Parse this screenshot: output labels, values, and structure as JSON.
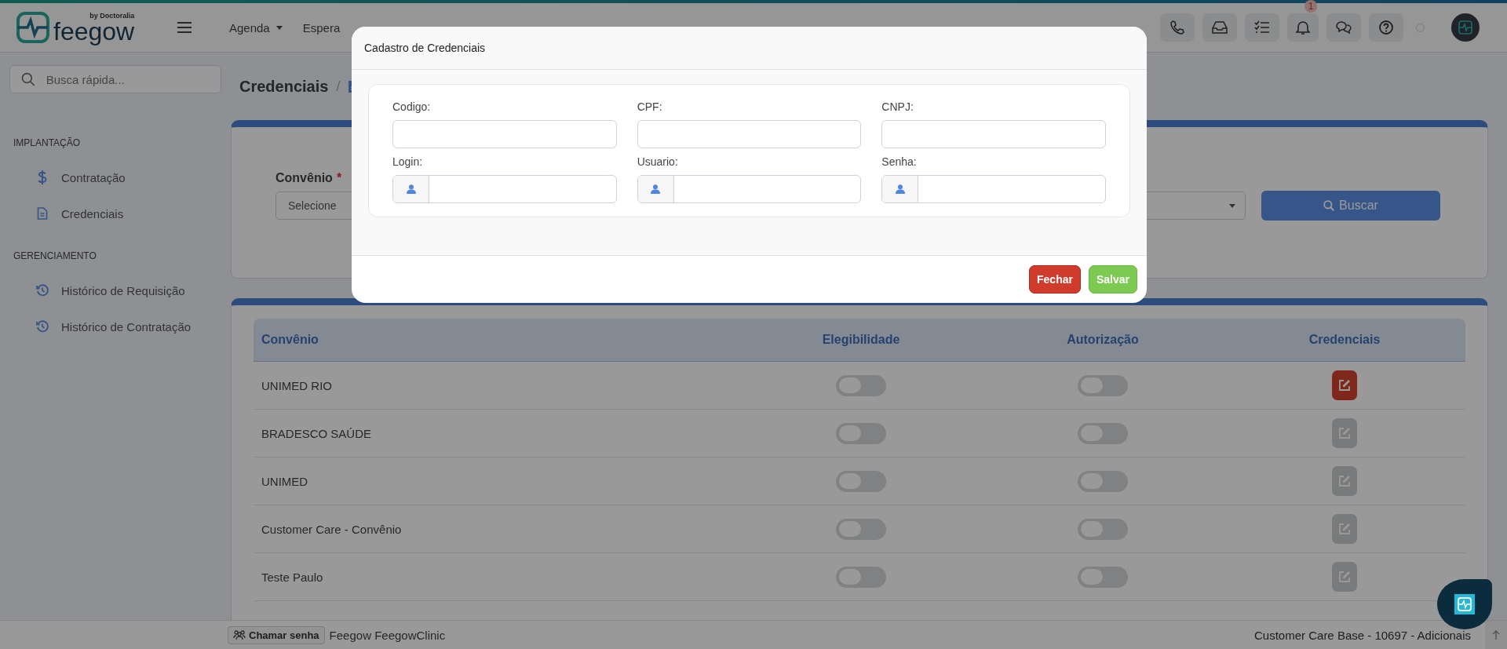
{
  "top_nav": {
    "logo": {
      "wordmark": "feegow",
      "byline": "by Doctoralia"
    },
    "menu": [
      {
        "label": "Agenda",
        "has_dropdown": true
      },
      {
        "label": "Espera",
        "has_dropdown": false
      }
    ],
    "notification_count": "1"
  },
  "sidebar": {
    "search": {
      "placeholder": "Busca rápida..."
    },
    "sections": [
      {
        "title": "IMPLANTAÇÃO",
        "items": [
          {
            "label": "Contratação",
            "kind": "dollar"
          },
          {
            "label": "Credenciais",
            "kind": "document"
          }
        ]
      },
      {
        "title": "GERENCIAMENTO",
        "items": [
          {
            "label": "Histórico de Requisição",
            "kind": "history"
          },
          {
            "label": "Histórico de Contratação",
            "kind": "history"
          }
        ]
      }
    ]
  },
  "breadcrumb": {
    "title": "Credenciais",
    "separator": "/"
  },
  "filter": {
    "label": "Convênio",
    "required_mark": "*",
    "select_value": "Selecione",
    "button": "Buscar"
  },
  "table": {
    "columns": [
      "Convênio",
      "Elegibilidade",
      "Autorização",
      "Credenciais"
    ],
    "rows": [
      {
        "convenio": "UNIMED RIO",
        "elegibilidade": false,
        "autorizacao": false,
        "credentials_enabled": true
      },
      {
        "convenio": "BRADESCO SAÚDE",
        "elegibilidade": false,
        "autorizacao": false,
        "credentials_enabled": false
      },
      {
        "convenio": "UNIMED",
        "elegibilidade": false,
        "autorizacao": false,
        "credentials_enabled": false
      },
      {
        "convenio": "Customer Care - Convênio",
        "elegibilidade": false,
        "autorizacao": false,
        "credentials_enabled": false
      },
      {
        "convenio": "Teste Paulo",
        "elegibilidade": false,
        "autorizacao": false,
        "credentials_enabled": false
      }
    ]
  },
  "modal": {
    "title": "Cadastro de Credenciais",
    "fields": [
      {
        "label": "Codigo:",
        "kind": "text"
      },
      {
        "label": "CPF:",
        "kind": "text"
      },
      {
        "label": "CNPJ:",
        "kind": "text"
      },
      {
        "label": "Login:",
        "kind": "user"
      },
      {
        "label": "Usuario:",
        "kind": "user"
      },
      {
        "label": "Senha:",
        "kind": "user"
      }
    ],
    "buttons": [
      {
        "label": "Fechar",
        "kind": "danger"
      },
      {
        "label": "Salvar",
        "kind": "success"
      }
    ]
  },
  "footer": {
    "call_button": "Chamar senha",
    "app_name": "Feegow FeegowClinic",
    "account": "Customer Care Base - 10697 - Adicionais"
  }
}
